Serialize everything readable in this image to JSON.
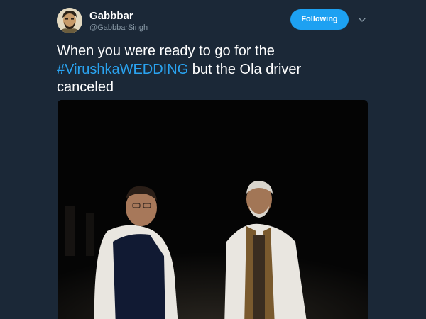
{
  "tweet": {
    "user": {
      "display_name": "Gabbbar",
      "handle": "@GabbbarSingh",
      "avatar_icon": "avatar-illustration"
    },
    "follow_button_label": "Following",
    "menu_icon": "chevron-down-icon",
    "text_line1": "When you were ready to go for the",
    "hashtag": "#VirushkaWEDDING",
    "text_after_hashtag": " but the Ola driver",
    "text_line3": "canceled",
    "media": {
      "kind": "photo",
      "description_icon": "night-photo"
    }
  },
  "colors": {
    "background": "#1b2837",
    "text": "#ffffff",
    "secondary_text": "#8899a6",
    "accent": "#1da1f2",
    "hashtag": "#2aa3f0"
  }
}
